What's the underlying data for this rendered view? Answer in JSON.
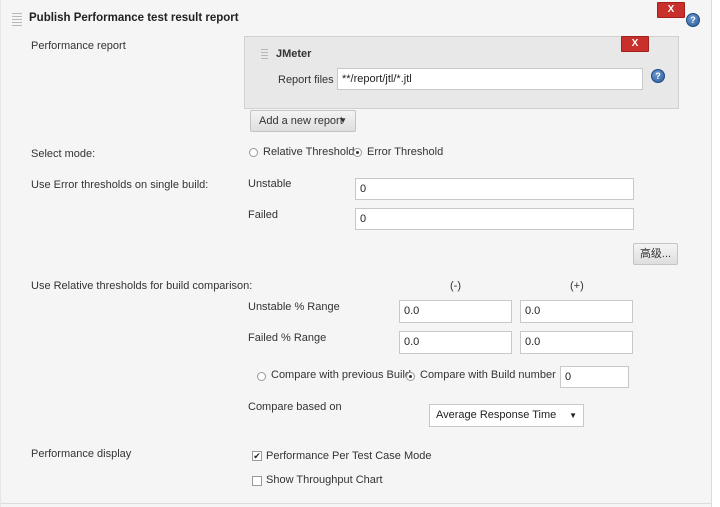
{
  "section": {
    "title": "Publish Performance test result report",
    "delete_label": "X",
    "help": "?"
  },
  "performance_report": {
    "label": "Performance report",
    "jmeter": {
      "title": "JMeter",
      "delete_label": "X",
      "report_files_label": "Report files",
      "report_files_value": "**/report/jtl/*.jtl",
      "help": "?"
    },
    "add_report_label": "Add a new report"
  },
  "select_mode": {
    "label": "Select mode:",
    "options": [
      "Relative Threshold",
      "Error Threshold"
    ],
    "selected": "Error Threshold"
  },
  "error_thresholds": {
    "label": "Use Error thresholds on single build:",
    "unstable_label": "Unstable",
    "unstable_value": "0",
    "failed_label": "Failed",
    "failed_value": "0",
    "advanced_label": "高级..."
  },
  "relative_thresholds": {
    "label": "Use Relative thresholds for build comparison:",
    "minus_header": "(-)",
    "plus_header": "(+)",
    "unstable_label": "Unstable % Range",
    "unstable_minus": "0.0",
    "unstable_plus": "0.0",
    "failed_label": "Failed % Range",
    "failed_minus": "0.0",
    "failed_plus": "0.0",
    "compare_options": [
      "Compare with previous Build",
      "Compare with Build number"
    ],
    "compare_selected": "Compare with Build number",
    "build_number_value": "0",
    "compare_based_label": "Compare based on",
    "compare_based_value": "Average Response Time"
  },
  "performance_display": {
    "label": "Performance display",
    "per_test_case_label": "Performance Per Test Case Mode",
    "per_test_case_checked": true,
    "throughput_label": "Show Throughput Chart",
    "throughput_checked": false,
    "check_glyph": "✔"
  },
  "colors": {
    "delete": "#c9302c",
    "help": "#2a5c9a",
    "panel_bg": "#f5f5f5"
  }
}
